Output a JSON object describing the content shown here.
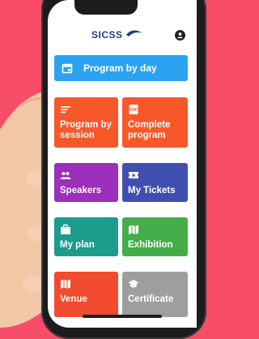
{
  "app": {
    "logo_text": "SICSS"
  },
  "tiles": [
    {
      "label": "Program by day",
      "color": "#2ba3f0",
      "icon": "calendar-icon"
    },
    {
      "label": "Program by session",
      "color": "#f7582a",
      "icon": "list-icon"
    },
    {
      "label": "Complete program",
      "color": "#f7582a",
      "icon": "pdf-icon"
    },
    {
      "label": "Speakers",
      "color": "#9c2fbb",
      "icon": "people-icon"
    },
    {
      "label": "My Tickets",
      "color": "#3f4fb0",
      "icon": "ticket-icon"
    },
    {
      "label": "My plan",
      "color": "#1b9c8c",
      "icon": "briefcase-icon"
    },
    {
      "label": "Exhibition",
      "color": "#44ad4a",
      "icon": "map-icon"
    },
    {
      "label": "Venue",
      "color": "#f24b2f",
      "icon": "map-icon"
    },
    {
      "label": "Certificate",
      "color": "#9e9e9e",
      "icon": "graduation-cap-icon"
    }
  ]
}
